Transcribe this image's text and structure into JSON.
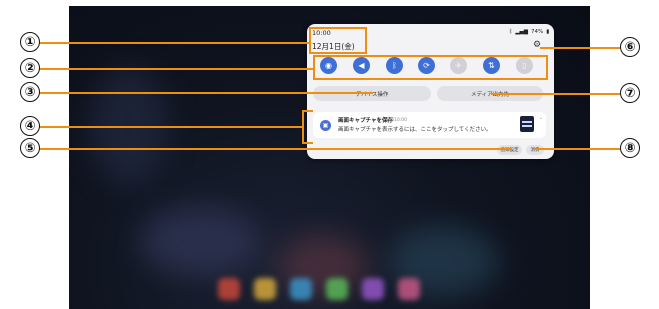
{
  "panel": {
    "time": "10:00",
    "date": "12月1日(金)",
    "status_text": "74%",
    "quick_settings": [
      {
        "icon": "wifi-icon",
        "glyph": "◉",
        "state": "on"
      },
      {
        "icon": "sound-icon",
        "glyph": "◀",
        "state": "on"
      },
      {
        "icon": "bluetooth-icon",
        "glyph": "ᛒ",
        "state": "on"
      },
      {
        "icon": "auto-rotate-icon",
        "glyph": "⟳",
        "state": "on"
      },
      {
        "icon": "airplane-mode-icon",
        "glyph": "✈",
        "state": "off"
      },
      {
        "icon": "data-sync-icon",
        "glyph": "⇅",
        "state": "on"
      },
      {
        "icon": "screen-icon",
        "glyph": "▯",
        "state": "off"
      }
    ],
    "device_control_label": "デバイス操作",
    "media_output_label": "メディア出力先",
    "notification": {
      "title": "画面キャプチャを保存",
      "time": "午前10:00",
      "body": "画面キャプチャを表示するには、ここをタップしてください。"
    },
    "notification_settings_label": "通知設定",
    "clear_label": "消去"
  },
  "callouts": [
    "①",
    "②",
    "③",
    "④",
    "⑤",
    "⑥",
    "⑦",
    "⑧"
  ],
  "colors": {
    "accent": "#3d6fd6",
    "highlight": "#ef8f12"
  }
}
